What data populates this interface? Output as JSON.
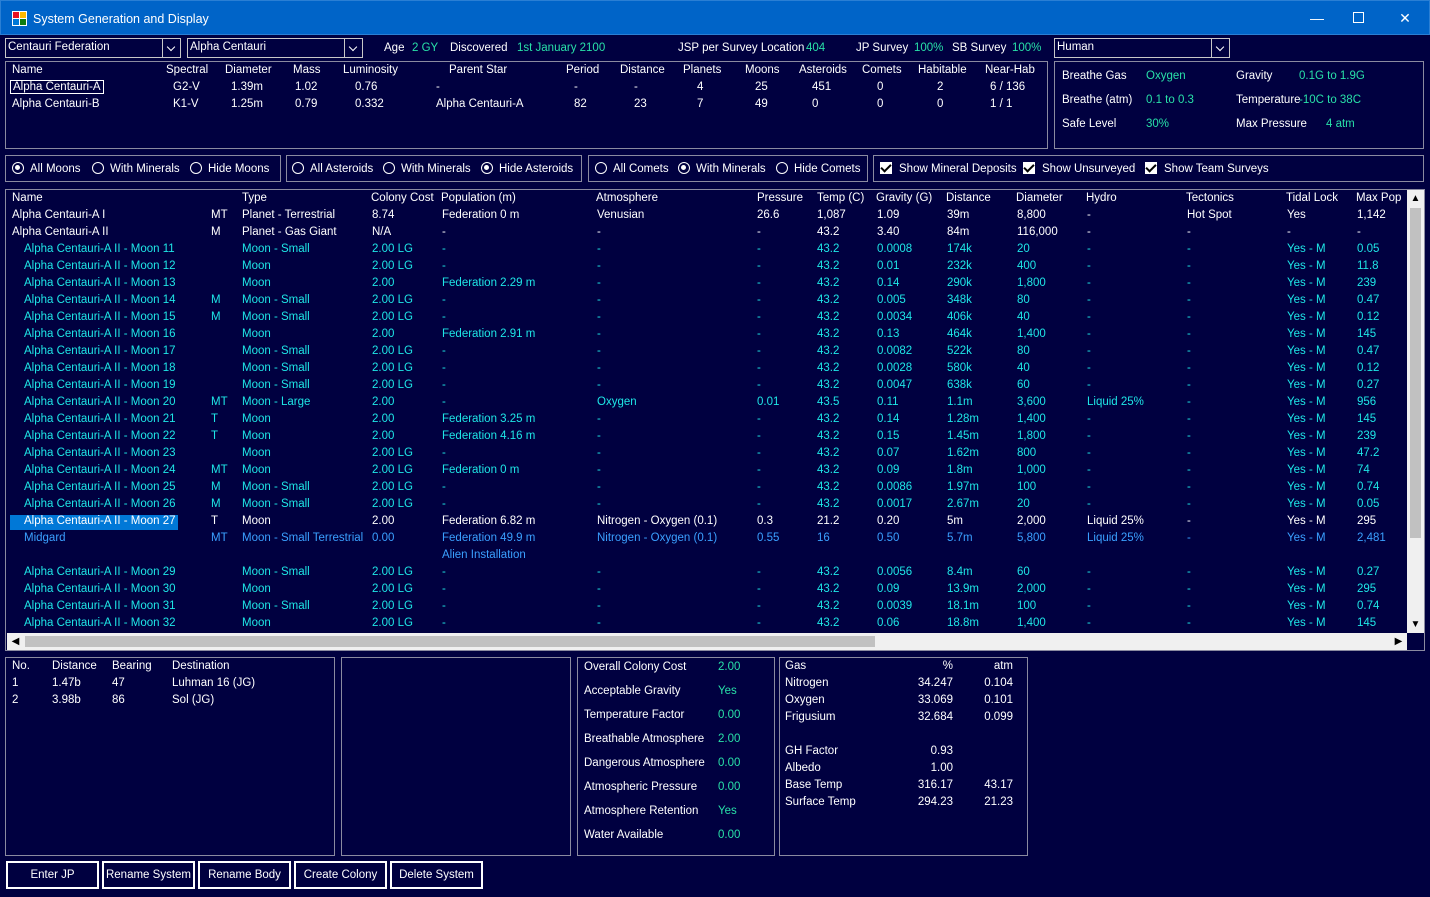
{
  "window": {
    "title": "System Generation and Display"
  },
  "top": {
    "race_combo": "Centauri Federation",
    "system_combo": "Alpha Centauri",
    "age_label": "Age",
    "age_value": "2 GY",
    "discovered_label": "Discovered",
    "discovered_value": "1st January 2100",
    "jsp_label": "JSP per Survey Location",
    "jsp_value": "404",
    "jp_label": "JP Survey",
    "jp_value": "100%",
    "sb_label": "SB Survey",
    "sb_value": "100%",
    "species_combo": "Human"
  },
  "stars": {
    "headers": [
      "Name",
      "Spectral",
      "Diameter",
      "Mass",
      "Luminosity",
      "Parent Star",
      "Period",
      "Distance",
      "Planets",
      "Moons",
      "Asteroids",
      "Comets",
      "Habitable",
      "Near-Hab"
    ],
    "rows": [
      [
        "Alpha Centauri-A",
        "G2-V",
        "1.39m",
        "1.02",
        "0.76",
        "-",
        "-",
        "-",
        "4",
        "25",
        "451",
        "0",
        "2",
        "6 / 136"
      ],
      [
        "Alpha Centauri-B",
        "K1-V",
        "1.25m",
        "0.79",
        "0.332",
        "Alpha Centauri-A",
        "82",
        "23",
        "7",
        "49",
        "0",
        "0",
        "0",
        "1 / 1"
      ]
    ]
  },
  "species": {
    "breathe_gas_label": "Breathe Gas",
    "breathe_gas_value": "Oxygen",
    "gravity_label": "Gravity",
    "gravity_value": "0.1G  to  1.9G",
    "breathe_atm_label": "Breathe (atm)",
    "breathe_atm_value": "0.1  to  0.3",
    "temperature_label": "Temperature",
    "temperature_value": "-10C  to  38C",
    "safe_level_label": "Safe Level",
    "safe_level_value": "30%",
    "max_pressure_label": "Max Pressure",
    "max_pressure_value": "4 atm"
  },
  "filters": {
    "moons": [
      "All Moons",
      "With Minerals",
      "Hide Moons"
    ],
    "asteroids": [
      "All Asteroids",
      "With Minerals",
      "Hide Asteroids"
    ],
    "comets": [
      "All Comets",
      "With Minerals",
      "Hide Comets"
    ],
    "checks": [
      "Show Mineral Deposits",
      "Show Unsurveyed",
      "Show Team Surveys"
    ]
  },
  "bodies": {
    "headers": [
      "Name",
      "",
      "Type",
      "Colony Cost",
      "Population (m)",
      "Atmosphere",
      "Pressure",
      "Temp (C)",
      "Gravity (G)",
      "Distance",
      "Diameter",
      "Hydro",
      "Tectonics",
      "Tidal Lock",
      "Max Pop"
    ],
    "rows": [
      {
        "s": "w",
        "c": [
          "Alpha Centauri-A I",
          "MT",
          "Planet - Terrestrial",
          "8.74",
          "Federation 0 m",
          "Venusian",
          "26.6",
          "1,087",
          "1.09",
          "39m",
          "8,800",
          "-",
          "Hot Spot",
          "Yes",
          "1,142"
        ]
      },
      {
        "s": "w",
        "c": [
          "Alpha Centauri-A II",
          "M",
          "Planet - Gas Giant",
          "N/A",
          "-",
          "-",
          "-",
          "43.2",
          "3.40",
          "84m",
          "116,000",
          "-",
          "-",
          "-",
          "-"
        ]
      },
      {
        "s": "c",
        "c": [
          "Alpha Centauri-A II - Moon 11",
          "",
          "Moon - Small",
          "2.00 LG",
          "-",
          "-",
          "-",
          "43.2",
          "0.0008",
          "174k",
          "20",
          "-",
          "-",
          "Yes - M",
          "0.05"
        ]
      },
      {
        "s": "c",
        "c": [
          "Alpha Centauri-A II - Moon 12",
          "",
          "Moon",
          "2.00 LG",
          "-",
          "-",
          "-",
          "43.2",
          "0.01",
          "232k",
          "400",
          "-",
          "-",
          "Yes - M",
          "11.8"
        ]
      },
      {
        "s": "c",
        "c": [
          "Alpha Centauri-A II - Moon 13",
          "",
          "Moon",
          "2.00",
          "Federation 2.29 m",
          "-",
          "-",
          "43.2",
          "0.14",
          "290k",
          "1,800",
          "-",
          "-",
          "Yes - M",
          "239"
        ]
      },
      {
        "s": "c",
        "c": [
          "Alpha Centauri-A II - Moon 14",
          "M",
          "Moon - Small",
          "2.00 LG",
          "-",
          "-",
          "-",
          "43.2",
          "0.005",
          "348k",
          "80",
          "-",
          "-",
          "Yes - M",
          "0.47"
        ]
      },
      {
        "s": "c",
        "c": [
          "Alpha Centauri-A II - Moon 15",
          "M",
          "Moon - Small",
          "2.00 LG",
          "-",
          "-",
          "-",
          "43.2",
          "0.0034",
          "406k",
          "40",
          "-",
          "-",
          "Yes - M",
          "0.12"
        ]
      },
      {
        "s": "c",
        "c": [
          "Alpha Centauri-A II - Moon 16",
          "",
          "Moon",
          "2.00",
          "Federation 2.91 m",
          "-",
          "-",
          "43.2",
          "0.13",
          "464k",
          "1,400",
          "-",
          "-",
          "Yes - M",
          "145"
        ]
      },
      {
        "s": "c",
        "c": [
          "Alpha Centauri-A II - Moon 17",
          "",
          "Moon - Small",
          "2.00 LG",
          "-",
          "-",
          "-",
          "43.2",
          "0.0082",
          "522k",
          "80",
          "-",
          "-",
          "Yes - M",
          "0.47"
        ]
      },
      {
        "s": "c",
        "c": [
          "Alpha Centauri-A II - Moon 18",
          "",
          "Moon - Small",
          "2.00 LG",
          "-",
          "-",
          "-",
          "43.2",
          "0.0028",
          "580k",
          "40",
          "-",
          "-",
          "Yes - M",
          "0.12"
        ]
      },
      {
        "s": "c",
        "c": [
          "Alpha Centauri-A II - Moon 19",
          "",
          "Moon - Small",
          "2.00 LG",
          "-",
          "-",
          "-",
          "43.2",
          "0.0047",
          "638k",
          "60",
          "-",
          "-",
          "Yes - M",
          "0.27"
        ]
      },
      {
        "s": "c",
        "c": [
          "Alpha Centauri-A II - Moon 20",
          "MT",
          "Moon - Large",
          "2.00",
          "-",
          "Oxygen",
          "0.01",
          "43.5",
          "0.11",
          "1.1m",
          "3,600",
          "Liquid 25%",
          "-",
          "Yes - M",
          "956"
        ]
      },
      {
        "s": "c",
        "c": [
          "Alpha Centauri-A II - Moon 21",
          "T",
          "Moon",
          "2.00",
          "Federation 3.25 m",
          "-",
          "-",
          "43.2",
          "0.14",
          "1.28m",
          "1,400",
          "-",
          "-",
          "Yes - M",
          "145"
        ]
      },
      {
        "s": "c",
        "c": [
          "Alpha Centauri-A II - Moon 22",
          "T",
          "Moon",
          "2.00",
          "Federation 4.16 m",
          "-",
          "-",
          "43.2",
          "0.15",
          "1.45m",
          "1,800",
          "-",
          "-",
          "Yes - M",
          "239"
        ]
      },
      {
        "s": "c",
        "c": [
          "Alpha Centauri-A II - Moon 23",
          "",
          "Moon",
          "2.00 LG",
          "-",
          "-",
          "-",
          "43.2",
          "0.07",
          "1.62m",
          "800",
          "-",
          "-",
          "Yes - M",
          "47.2"
        ]
      },
      {
        "s": "c",
        "c": [
          "Alpha Centauri-A II - Moon 24",
          "MT",
          "Moon",
          "2.00 LG",
          "Federation 0 m",
          "-",
          "-",
          "43.2",
          "0.09",
          "1.8m",
          "1,000",
          "-",
          "-",
          "Yes - M",
          "74"
        ]
      },
      {
        "s": "c",
        "c": [
          "Alpha Centauri-A II - Moon 25",
          "M",
          "Moon - Small",
          "2.00 LG",
          "-",
          "-",
          "-",
          "43.2",
          "0.0086",
          "1.97m",
          "100",
          "-",
          "-",
          "Yes - M",
          "0.74"
        ]
      },
      {
        "s": "c",
        "c": [
          "Alpha Centauri-A II - Moon 26",
          "M",
          "Moon - Small",
          "2.00 LG",
          "-",
          "-",
          "-",
          "43.2",
          "0.0017",
          "2.67m",
          "20",
          "-",
          "-",
          "Yes - M",
          "0.05"
        ]
      },
      {
        "s": "sel",
        "c": [
          "Alpha Centauri-A II - Moon 27",
          "T",
          "Moon",
          "2.00",
          "Federation 6.82 m",
          "Nitrogen - Oxygen (0.1)",
          "0.3",
          "21.2",
          "0.20",
          "5m",
          "2,000",
          "Liquid 25%",
          "-",
          "Yes - M",
          "295"
        ]
      },
      {
        "s": "b",
        "c": [
          "Midgard",
          "MT",
          "Moon - Small Terrestrial",
          "0.00",
          "Federation 49.9 m",
          "Nitrogen - Oxygen (0.1)",
          "0.55",
          "16",
          "0.50",
          "5.7m",
          "5,800",
          "Liquid 25%",
          "-",
          "Yes - M",
          "2,481"
        ],
        "sub": "Alien Installation"
      },
      {
        "s": "c",
        "c": [
          "Alpha Centauri-A II - Moon 29",
          "",
          "Moon - Small",
          "2.00 LG",
          "-",
          "-",
          "-",
          "43.2",
          "0.0056",
          "8.4m",
          "60",
          "-",
          "-",
          "Yes - M",
          "0.27"
        ]
      },
      {
        "s": "c",
        "c": [
          "Alpha Centauri-A II - Moon 30",
          "",
          "Moon",
          "2.00 LG",
          "-",
          "-",
          "-",
          "43.2",
          "0.09",
          "13.9m",
          "2,000",
          "-",
          "-",
          "Yes - M",
          "295"
        ]
      },
      {
        "s": "c",
        "c": [
          "Alpha Centauri-A II - Moon 31",
          "",
          "Moon - Small",
          "2.00 LG",
          "-",
          "-",
          "-",
          "43.2",
          "0.0039",
          "18.1m",
          "100",
          "-",
          "-",
          "Yes - M",
          "0.74"
        ]
      },
      {
        "s": "c",
        "c": [
          "Alpha Centauri-A II - Moon 32",
          "",
          "Moon",
          "2.00 LG",
          "-",
          "-",
          "-",
          "43.2",
          "0.06",
          "18.8m",
          "1,400",
          "-",
          "-",
          "Yes - M",
          "145"
        ]
      }
    ]
  },
  "jump_points": {
    "headers": [
      "No.",
      "Distance",
      "Bearing",
      "Destination"
    ],
    "rows": [
      [
        "1",
        "1.47b",
        "47",
        "Luhman 16 (JG)"
      ],
      [
        "2",
        "3.98b",
        "86",
        "Sol (JG)"
      ]
    ]
  },
  "colony_cost": {
    "rows": [
      [
        "Overall Colony Cost",
        "2.00"
      ],
      [
        "Acceptable Gravity",
        "Yes"
      ],
      [
        "Temperature Factor",
        "0.00"
      ],
      [
        "Breathable Atmosphere",
        "2.00"
      ],
      [
        "Dangerous Atmosphere",
        "0.00"
      ],
      [
        "Atmospheric Pressure",
        "0.00"
      ],
      [
        "Atmosphere Retention",
        "Yes"
      ],
      [
        "Water Available",
        "0.00"
      ]
    ]
  },
  "atmosphere": {
    "headers": [
      "Gas",
      "%",
      "atm"
    ],
    "gases": [
      [
        "Nitrogen",
        "34.247",
        "0.104"
      ],
      [
        "Oxygen",
        "33.069",
        "0.101"
      ],
      [
        "Frigusium",
        "32.684",
        "0.099"
      ]
    ],
    "stats": [
      [
        "GH Factor",
        "0.93",
        ""
      ],
      [
        "Albedo",
        "1.00",
        ""
      ],
      [
        "Base Temp",
        "316.17",
        "43.17"
      ],
      [
        "Surface Temp",
        "294.23",
        "21.23"
      ]
    ]
  },
  "buttons": [
    "Enter JP",
    "Rename System",
    "Rename Body",
    "Create Colony",
    "Delete System"
  ],
  "colors": {
    "background": "#000040",
    "titlebar": "#0064c8",
    "green_value": "#28e0a8",
    "cyan": "#1ee6e6",
    "light_blue": "#3aa0ff",
    "selection": "#0078d7"
  }
}
